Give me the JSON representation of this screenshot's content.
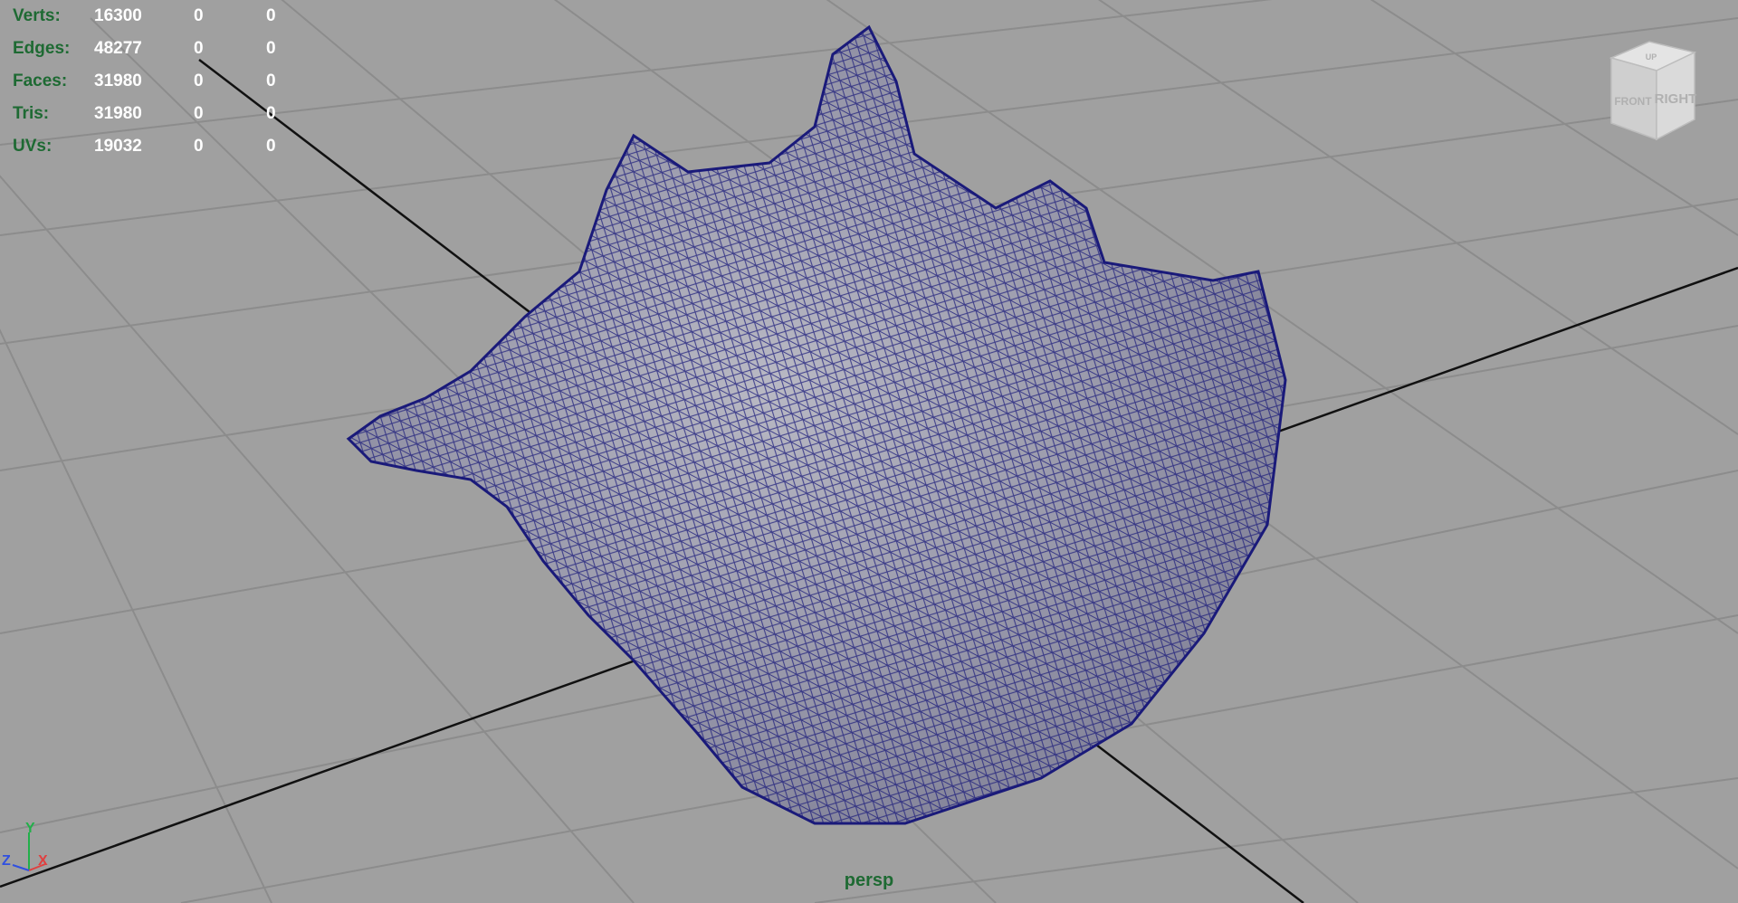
{
  "viewport": {
    "camera": "persp",
    "colors": {
      "background": "#a0a0a0",
      "grid": "#8c8c8c",
      "axis_line": "#111111",
      "wireframe": "#1a1a7a",
      "hud_label": "#1e6a33",
      "hud_value": "#ffffff"
    }
  },
  "hud": {
    "rows": [
      {
        "label": "Verts:",
        "total": "16300",
        "selected": "0",
        "triangles": "0"
      },
      {
        "label": "Edges:",
        "total": "48277",
        "selected": "0",
        "triangles": "0"
      },
      {
        "label": "Faces:",
        "total": "31980",
        "selected": "0",
        "triangles": "0"
      },
      {
        "label": "Tris:",
        "total": "31980",
        "selected": "0",
        "triangles": "0"
      },
      {
        "label": "UVs:",
        "total": "19032",
        "selected": "0",
        "triangles": "0"
      }
    ]
  },
  "view_cube": {
    "face_front": "FRONT",
    "face_right": "RIGHT",
    "face_top": "UP"
  },
  "axis": {
    "x": "X",
    "y": "Y",
    "z": "Z"
  }
}
